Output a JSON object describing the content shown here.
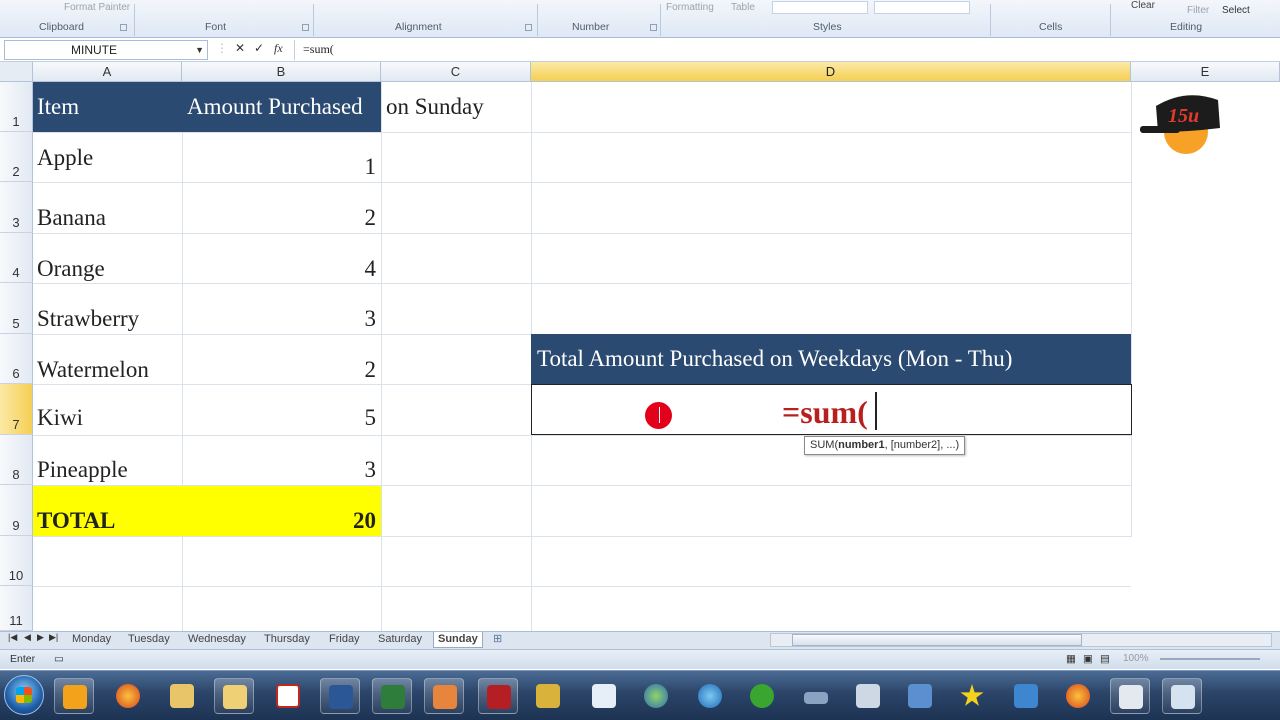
{
  "ribbon": {
    "top_stub": "Format Painter",
    "groups": [
      "Clipboard",
      "Font",
      "Alignment",
      "Number",
      "Styles",
      "Cells",
      "Editing"
    ],
    "stub_formatting": "Formatting",
    "stub_table": "Table",
    "stub_clear": "Clear",
    "stub_filter": "Filter",
    "stub_select": "Select"
  },
  "formula_bar": {
    "name_box": "MINUTE",
    "cancel_glyph": "✕",
    "enter_glyph": "✓",
    "fx_label": "fx",
    "formula": "=sum("
  },
  "columns": [
    "A",
    "B",
    "C",
    "D",
    "E"
  ],
  "rows": [
    "1",
    "2",
    "3",
    "4",
    "5",
    "6",
    "7",
    "8",
    "9",
    "10",
    "11"
  ],
  "table": {
    "header_item": "Item",
    "header_amount": "Amount Purchased",
    "c1_text": "on Sunday",
    "items": [
      {
        "name": "Apple",
        "amount": "1"
      },
      {
        "name": "Banana",
        "amount": "2"
      },
      {
        "name": "Orange",
        "amount": "4"
      },
      {
        "name": "Strawberry",
        "amount": "3"
      },
      {
        "name": "Watermelon",
        "amount": "2"
      },
      {
        "name": "Kiwi",
        "amount": "5"
      },
      {
        "name": "Pineapple",
        "amount": "3"
      }
    ],
    "total_label": "TOTAL",
    "total_value": "20"
  },
  "summary": {
    "header": "Total Amount Purchased on Weekdays (Mon - Thu)",
    "editing_value": "=sum("
  },
  "tooltip": {
    "fn": "SUM(",
    "arg1": "number1",
    "rest": ", [number2], ...)"
  },
  "sheet_tabs": [
    "Monday",
    "Tuesday",
    "Wednesday",
    "Thursday",
    "Friday",
    "Saturday",
    "Sunday"
  ],
  "active_sheet": "Sunday",
  "status": {
    "mode": "Enter",
    "zoom": "100%"
  },
  "colors": {
    "header_fill": "#2a4a71",
    "total_fill": "#ffff00",
    "edit_text": "#b7201e",
    "active_header": "#f5cf54"
  }
}
